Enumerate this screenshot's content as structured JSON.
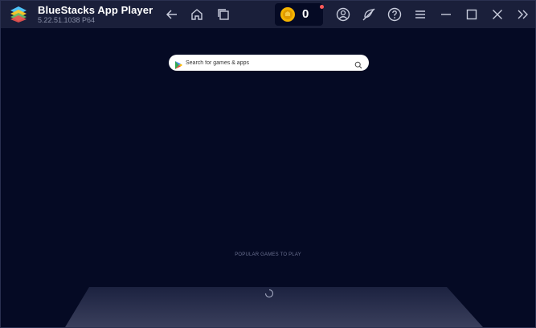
{
  "window": {
    "title": "BlueStacks App Player",
    "version": "5.22.51.1038  P64"
  },
  "toolbar": {
    "icons": [
      "back-arrow-icon",
      "home-icon",
      "multi-instance-icon",
      "account-icon",
      "eco-mode-icon",
      "help-icon",
      "menu-icon",
      "minimize-icon",
      "maximize-icon",
      "close-icon",
      "sidebar-toggle-icon"
    ]
  },
  "coins": {
    "count": "0",
    "notification": true
  },
  "search": {
    "placeholder": "Search for games & apps"
  },
  "section": {
    "popular_label": "POPULAR GAMES TO PLAY"
  },
  "colors": {
    "background": "#050a24",
    "titlebar": "#1a1f3a",
    "coin": "#f5b400",
    "notification_dot": "#ff5a5a"
  }
}
